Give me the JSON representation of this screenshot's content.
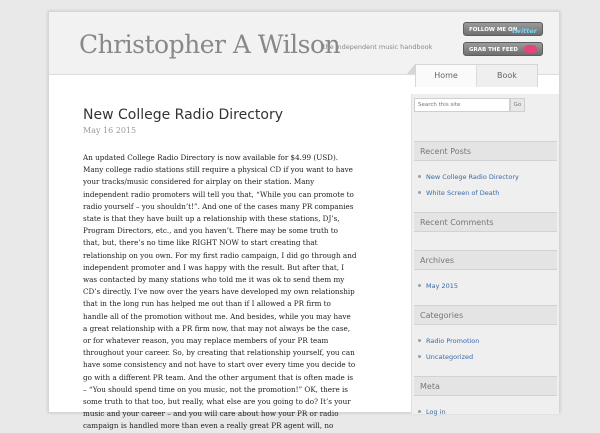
{
  "site": {
    "title": "Christopher A Wilson",
    "tagline": "the independent music handbook"
  },
  "badges": {
    "follow_text": "FOLLOW ME ON",
    "follow_brand": "twitter",
    "feed_text": "GRAB THE FEED"
  },
  "nav": [
    {
      "label": "Home"
    },
    {
      "label": "Book"
    }
  ],
  "post": {
    "title": "New College Radio Directory",
    "date": "May 16 2015",
    "lines": [
      "An updated College Radio Directory is now available for $4.99 (USD).",
      "Many college radio stations still require a physical CD if you want to have",
      "your tracks/music considered for airplay on their station. Many",
      "independent radio promoters will tell you that, “While you can promote to",
      "radio yourself – you shouldn’t!”. And one of the cases many PR companies",
      "state is that they have built up a relationship with these stations, DJ’s,",
      "Program Directors, etc., and you haven’t. There may be some truth to",
      "that, but, there’s no time like RIGHT NOW to start creating that",
      "relationship on you own. For my first radio campaign, I did go through and",
      "independent promoter and I was happy with the result. But after that, I",
      "was contacted by many stations who told me it was ok to send them my",
      "CD’s directly. I’ve now over the years have developed my own relationship",
      "that in the long run has helped me out than if I allowed a PR firm to",
      "handle all of the promotion without me. And besides, while you may have",
      "a great relationship with a PR firm now, that may not always be the case,",
      "or for whatever reason, you may replace members of your PR team",
      "throughout your career. So, by creating that relationship yourself, you can",
      "have some consistency and not have to start over every time you decide to",
      "go with a different PR team. And the other argument that is often made is",
      "– “You should spend time on you music, not the promotion!” OK, there is",
      "some truth to that too, but really, what else are you going to do? It’s your",
      "music and your career – and  you will care about how your PR or radio",
      "campaign is handled more than even a really great PR agent will, no"
    ]
  },
  "sidebar": {
    "search_placeholder": "Search this site",
    "search_button": "Go",
    "recent_posts": {
      "heading": "Recent Posts",
      "items": [
        "New College Radio Directory",
        "White Screen of Death"
      ]
    },
    "recent_comments": {
      "heading": "Recent Comments"
    },
    "archives": {
      "heading": "Archives",
      "items": [
        "May 2015"
      ]
    },
    "categories": {
      "heading": "Categories",
      "items": [
        "Radio Promotion",
        "Uncategorized"
      ]
    },
    "meta": {
      "heading": "Meta",
      "items": [
        "Log in"
      ]
    }
  },
  "colors": {
    "link": "#3a6aa8",
    "title_gray": "#888888",
    "rss_pink": "#e6457a",
    "twitter_blue": "#7fd0f5"
  }
}
